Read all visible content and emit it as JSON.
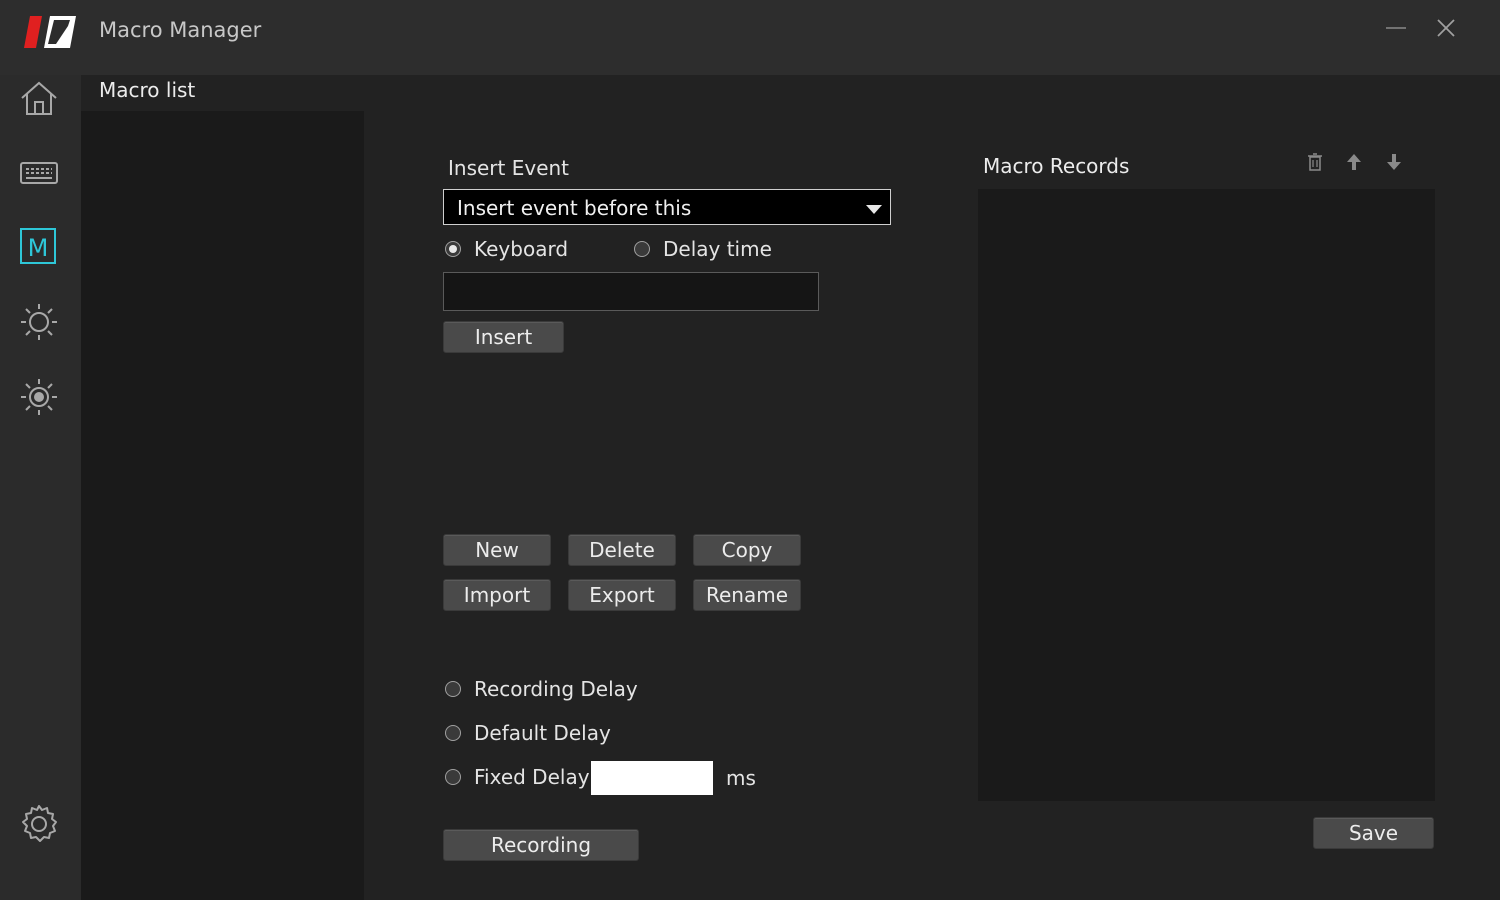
{
  "window": {
    "title": "Macro Manager",
    "logo": "brand-logo",
    "controls": [
      "minimize-icon",
      "close-icon"
    ]
  },
  "sidebar": {
    "items": [
      {
        "icon": "home-icon"
      },
      {
        "icon": "keyboard-icon"
      },
      {
        "icon": "macro-icon",
        "glyph": "M",
        "active": true
      },
      {
        "icon": "brightness-low-icon"
      },
      {
        "icon": "brightness-high-icon"
      }
    ],
    "footer_icon": "settings-gear-icon"
  },
  "macro_list": {
    "label": "Macro list",
    "items": []
  },
  "insert_event": {
    "label": "Insert Event",
    "dropdown_value": "Insert event before this",
    "radio_keyboard": "Keyboard",
    "radio_delay": "Delay time",
    "selected": "Keyboard",
    "input_value": "",
    "insert_button": "Insert"
  },
  "actions": {
    "new": "New",
    "delete": "Delete",
    "copy": "Copy",
    "import": "Import",
    "export": "Export",
    "rename": "Rename"
  },
  "delay_options": {
    "recording_delay": "Recording Delay",
    "default_delay": "Default Delay",
    "fixed_delay": "Fixed Delay",
    "fixed_value": "",
    "unit": "ms"
  },
  "recording_button": "Recording",
  "macro_records": {
    "title": "Macro Records",
    "tools": [
      "trash-icon",
      "arrow-up-icon",
      "arrow-down-icon"
    ],
    "records": []
  },
  "save_button": "Save",
  "colors": {
    "accent": "#2ec7d8",
    "brand_red": "#e02020",
    "background": "#222222",
    "titlebar": "#2d2d2d",
    "panel": "#1a1a1a"
  }
}
